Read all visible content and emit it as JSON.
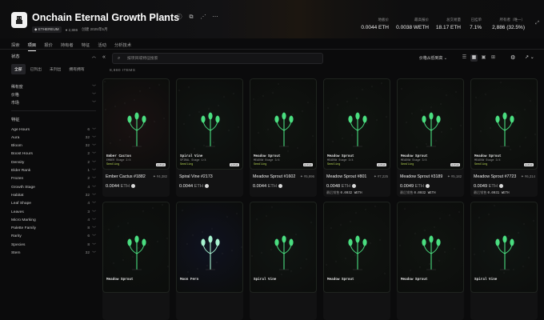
{
  "header": {
    "title": "Onchain Eternal Growth Plants",
    "chain": "ETHEREUM",
    "holders_chip": "2,886",
    "created": "创建 2025年5月",
    "stats": [
      {
        "label": "地板价",
        "value": "0.0044 ETH"
      },
      {
        "label": "最高报价",
        "value": "0.0038 WETH"
      },
      {
        "label": "总交易量",
        "value": "18.17 ETH"
      },
      {
        "label": "已挂单",
        "value": "7.1%"
      },
      {
        "label": "所有者（唯一）",
        "value": "2,886 (32.5%)"
      }
    ]
  },
  "tabs": [
    {
      "label": "探索",
      "active": false
    },
    {
      "label": "项目",
      "active": true
    },
    {
      "label": "报价",
      "active": false
    },
    {
      "label": "持有者",
      "active": false
    },
    {
      "label": "特征",
      "active": false
    },
    {
      "label": "活动",
      "active": false
    },
    {
      "label": "分析技术",
      "active": false
    }
  ],
  "sidebar": {
    "status_title": "状态",
    "status_options": [
      {
        "label": "全部",
        "active": true
      },
      {
        "label": "已列出",
        "active": false
      },
      {
        "label": "未列出",
        "active": false
      },
      {
        "label": "拥有拥有",
        "active": false
      }
    ],
    "groups": [
      {
        "label": "稀有度"
      },
      {
        "label": "价格"
      },
      {
        "label": "市场"
      }
    ],
    "traits_title": "特征",
    "traits": [
      {
        "name": "Age Hours",
        "count": "6"
      },
      {
        "name": "Aura",
        "count": "32"
      },
      {
        "name": "Bloom",
        "count": "32"
      },
      {
        "name": "Boost Hours",
        "count": "2"
      },
      {
        "name": "Density",
        "count": "2"
      },
      {
        "name": "Elder Rank",
        "count": "1"
      },
      {
        "name": "Frozen",
        "count": "2"
      },
      {
        "name": "Growth Stage",
        "count": "4"
      },
      {
        "name": "Habitat",
        "count": "32"
      },
      {
        "name": "Leaf Shape",
        "count": "4"
      },
      {
        "name": "Leaves",
        "count": "3"
      },
      {
        "name": "Micro Marking",
        "count": "4"
      },
      {
        "name": "Palette Family",
        "count": "8"
      },
      {
        "name": "Rarity",
        "count": "6"
      },
      {
        "name": "Species",
        "count": "8"
      },
      {
        "name": "Stem",
        "count": "32"
      }
    ]
  },
  "toolbar": {
    "search_placeholder": "按项目或特征搜索",
    "sort_label": "价格从低到高",
    "item_count": "8,880 ITEMS"
  },
  "cards": [
    {
      "art_name": "Ember Cactus",
      "art_sub": "EMBER Stage 2/4",
      "stage": "Seedling",
      "title": "Ember Cactus #1882",
      "rank": "#4,382",
      "price": "0.0044",
      "unit": "ETH",
      "last_label": "",
      "last_value": "",
      "leaf": "#4ade80",
      "bg": "#1a1212"
    },
    {
      "art_name": "Spiral Vine",
      "art_sub": "SPIRAL Stage 1/4",
      "stage": "Seedling",
      "title": "Spiral Vine #2173",
      "rank": "",
      "price": "0.0044",
      "unit": "ETH",
      "last_label": "",
      "last_value": "",
      "leaf": "#4ade80",
      "bg": "#101512"
    },
    {
      "art_name": "Meadow Sprout",
      "art_sub": "MEADOW Stage 3/4",
      "stage": "Seedling",
      "title": "Meadow Sprout #1602",
      "rank": "#5,996",
      "price": "0.0044",
      "unit": "ETH",
      "last_label": "",
      "last_value": "",
      "leaf": "#4ade80",
      "bg": "#101410"
    },
    {
      "art_name": "Meadow Sprout",
      "art_sub": "MEADOW Stage 3/4",
      "stage": "Seedling",
      "title": "Meadow Sprout #801",
      "rank": "#7,225",
      "price": "0.0048",
      "unit": "ETH",
      "last_label": "最后销售",
      "last_value": "0.0032 WETH",
      "leaf": "#4ade80",
      "bg": "#101410"
    },
    {
      "art_name": "Meadow Sprout",
      "art_sub": "MEADOW Stage 3/4",
      "stage": "Seedling",
      "title": "Meadow Sprout #3189",
      "rank": "#5,182",
      "price": "0.0049",
      "unit": "ETH",
      "last_label": "最后销售",
      "last_value": "0.0032 WETH",
      "leaf": "#4ade80",
      "bg": "#101410"
    },
    {
      "art_name": "Meadow Sprout",
      "art_sub": "MEADOW Stage 3/4",
      "stage": "Seedling",
      "title": "Meadow Sprout #7723",
      "rank": "#6,314",
      "price": "0.0049",
      "unit": "ETH",
      "last_label": "最后销售",
      "last_value": "0.0031 WETH",
      "leaf": "#4ade80",
      "bg": "#101410"
    },
    {
      "art_name": "Meadow Sprout",
      "leaf": "#4ade80",
      "bg": "#0e120f"
    },
    {
      "art_name": "Moon Fern",
      "leaf": "#a7f3d0",
      "bg": "#0f1220"
    },
    {
      "art_name": "Spiral Vine",
      "leaf": "#4ade80",
      "bg": "#101512"
    },
    {
      "art_name": "Meadow Sprout",
      "leaf": "#4ade80",
      "bg": "#101410"
    },
    {
      "art_name": "Meadow Sprout",
      "leaf": "#4ade80",
      "bg": "#101410"
    },
    {
      "art_name": "Spiral Vine",
      "leaf": "#4ade80",
      "bg": "#101512"
    }
  ],
  "colors": {
    "accent": "#4ade80",
    "stage": "#bada55",
    "background": "#0b0b0c"
  }
}
